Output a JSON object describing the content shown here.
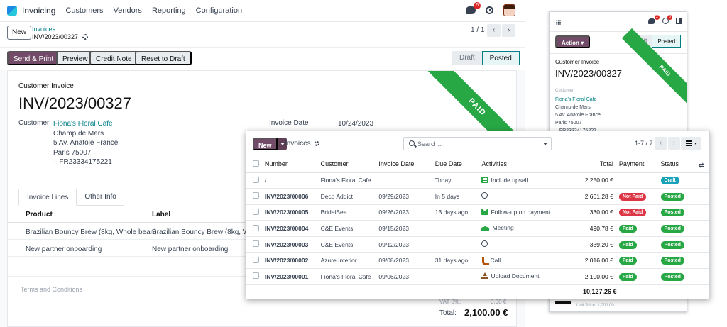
{
  "main": {
    "app_name": "Invoicing",
    "menu": [
      "Customers",
      "Vendors",
      "Reporting",
      "Configuration"
    ],
    "chat_badge": "6",
    "new_label": "New",
    "breadcrumb_parent": "Invoices",
    "breadcrumb_current": "INV/2023/00327",
    "pager": "1 / 1",
    "actions": {
      "send_print": "Send & Print",
      "preview": "Preview",
      "credit_note": "Credit Note",
      "reset": "Reset to Draft"
    },
    "status": [
      "Draft",
      "Posted"
    ],
    "ribbon": "PAID",
    "doc_type": "Customer Invoice",
    "doc_name": "INV/2023/00327",
    "customer_label": "Customer",
    "customer_name": "Fiona's Floral Cafe",
    "address": [
      "Champ de Mars",
      "5 Av. Anatole France",
      "Paris 75007",
      "– FR23334175221"
    ],
    "invoice_date_label": "Invoice Date",
    "invoice_date": "10/24/2023",
    "tabs": [
      "Invoice Lines",
      "Other Info"
    ],
    "line_headers": [
      "Product",
      "Label"
    ],
    "lines": [
      {
        "product": "Brazilian Bouncy Brew (8kg, Whole bean)",
        "label": "Brazilian Bouncy Brew (8kg, Whole"
      },
      {
        "product": "New partner onboarding",
        "label": "New partner onboarding"
      }
    ],
    "terms_placeholder": "Terms and Conditions",
    "vat_peek": "VAT 0%:",
    "vat_peek_value": "0.00 €",
    "total_label": "Total:",
    "total_value": "2,100.00 €"
  },
  "mobile": {
    "chat_badge": "2",
    "clock_badge": "3",
    "action_label": "Action",
    "status": [
      "Draft",
      "Posted"
    ],
    "ribbon": "PAID",
    "doc_type": "Customer Invoice",
    "doc_name": "INV/2023/00327",
    "customer_label": "Customer",
    "customer_name": "Fiona's Floral Cafe",
    "address": [
      "Champ de Mars",
      "5 Av. Anatole France",
      "Paris 75007",
      "– FR23334175221"
    ],
    "unit_price": "Unit Price: 1,000.00"
  },
  "list": {
    "new_label": "New",
    "title": "Invoices",
    "search_placeholder": "Search...",
    "pager": "1-7 / 7",
    "columns": [
      "Number",
      "Customer",
      "Invoice Date",
      "Due Date",
      "Activities",
      "Total",
      "Payment",
      "Status"
    ],
    "rows": [
      {
        "number": "/",
        "customer": "Fiona's Floral Cafe",
        "date": "",
        "due": "Today",
        "due_style": "today",
        "activity": "Include upsell",
        "activity_icon": "upsell",
        "total": "2,250.00 €",
        "payment": "",
        "payment_style": "",
        "status": "Draft",
        "status_style": "teal"
      },
      {
        "number": "INV/2023/00006",
        "customer": "Deco Addict",
        "date": "09/29/2023",
        "due": "In 5 days",
        "due_style": "",
        "activity": "",
        "activity_icon": "clock",
        "total": "2,601.28 €",
        "payment": "Not Paid",
        "payment_style": "red",
        "status": "Posted",
        "status_style": "green"
      },
      {
        "number": "INV/2023/00005",
        "customer": "BridalBee",
        "date": "09/26/2023",
        "due": "13 days ago",
        "due_style": "overdue",
        "activity": "Follow-up on payment",
        "activity_icon": "mail",
        "total": "330.00 €",
        "payment": "Not Paid",
        "payment_style": "red",
        "status": "Posted",
        "status_style": "green"
      },
      {
        "number": "INV/2023/00004",
        "customer": "C&E Events",
        "date": "09/15/2023",
        "due": "",
        "due_style": "",
        "activity": "Meeting",
        "activity_icon": "meeting",
        "total": "490.78 €",
        "payment": "Paid",
        "payment_style": "green",
        "status": "Posted",
        "status_style": "green"
      },
      {
        "number": "INV/2023/00003",
        "customer": "C&E Events",
        "date": "09/12/2023",
        "due": "",
        "due_style": "",
        "activity": "",
        "activity_icon": "clock",
        "total": "339.20 €",
        "payment": "Paid",
        "payment_style": "green",
        "status": "Posted",
        "status_style": "green"
      },
      {
        "number": "INV/2023/00002",
        "customer": "Azure Interior",
        "date": "09/08/2023",
        "due": "31 days ago",
        "due_style": "overdue",
        "activity": "Call",
        "activity_icon": "phone",
        "total": "2,016.00 €",
        "payment": "Paid",
        "payment_style": "green",
        "status": "Posted",
        "status_style": "green"
      },
      {
        "number": "INV/2023/00001",
        "customer": "Fiona's Floral Cafe",
        "date": "09/06/2023",
        "due": "",
        "due_style": "",
        "activity": "Upload Document",
        "activity_icon": "upload",
        "total": "2,100.00 €",
        "payment": "Paid",
        "payment_style": "green",
        "status": "Posted",
        "status_style": "green"
      }
    ],
    "grand_total": "10,127.26 €"
  }
}
